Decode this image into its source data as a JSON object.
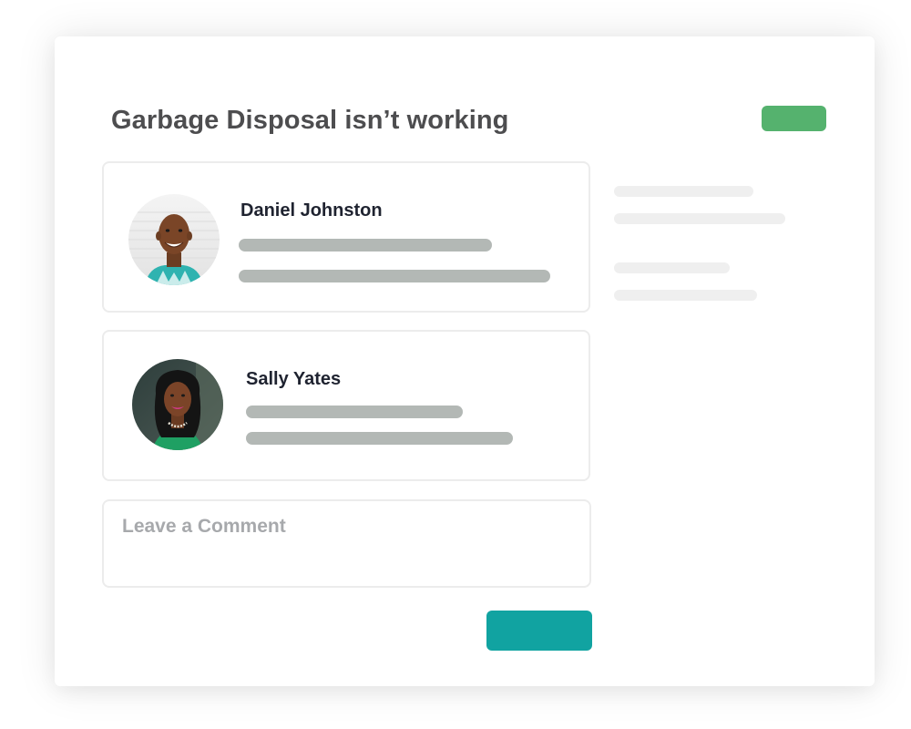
{
  "ticket": {
    "title": "Garbage Disposal isn’t working"
  },
  "colors": {
    "status_pill": "#55b26e",
    "submit_button": "#11a3a1",
    "text_placeholder_bar": "#b3b8b5",
    "sidebar_placeholder_line": "#efefef",
    "title_text": "#4d4d4f",
    "author_text": "#1f2330"
  },
  "comments": [
    {
      "author": "Daniel Johnston",
      "avatar": "avatar-photo"
    },
    {
      "author": "Sally Yates",
      "avatar": "avatar-photo"
    }
  ],
  "comment_form": {
    "placeholder": "Leave a Comment",
    "value": ""
  }
}
